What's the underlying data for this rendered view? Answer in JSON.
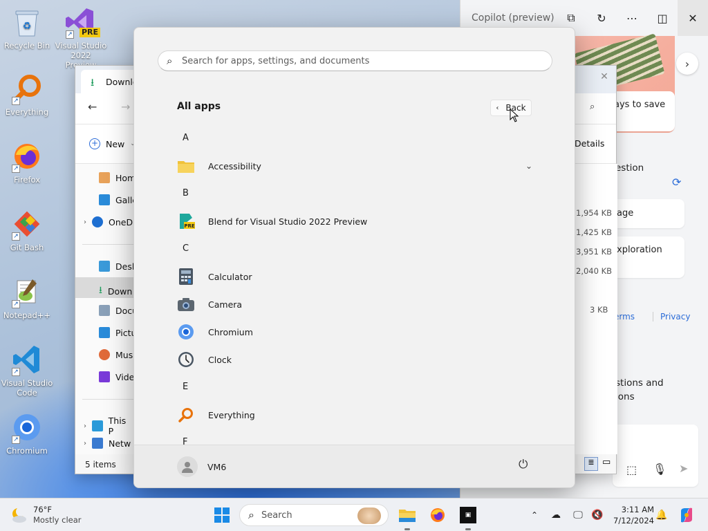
{
  "desktop": {
    "icons": [
      {
        "label": "Recycle Bin",
        "icon": "recycle-bin-icon"
      },
      {
        "label": "Visual Studio 2022 Preview",
        "icon": "visual-studio-preview-icon",
        "badge": "PRE"
      },
      {
        "label": "Everything",
        "icon": "everything-icon"
      },
      {
        "label": "Firefox",
        "icon": "firefox-icon"
      },
      {
        "label": "Git Bash",
        "icon": "git-bash-icon"
      },
      {
        "label": "Notepad++",
        "icon": "notepad-plus-plus-icon"
      },
      {
        "label": "Visual Studio Code",
        "icon": "vscode-icon"
      },
      {
        "label": "Chromium",
        "icon": "chromium-icon"
      }
    ]
  },
  "copilot": {
    "title": "Copilot (preview)",
    "card_text": "ays to save",
    "items": [
      "estion",
      "age",
      "xploration"
    ],
    "links": [
      "erms",
      "Privacy"
    ],
    "bottom_text": "stions and ions"
  },
  "explorer": {
    "tab": "Downlo",
    "new_label": "New",
    "details_label": "Details",
    "nav": [
      "Home",
      "Galler",
      "OneD",
      "Deskt",
      "Down",
      "Docu",
      "Pictur",
      "Music",
      "Video",
      "This P",
      "Netw"
    ],
    "sizes": [
      "1,954 KB",
      "1,425 KB",
      "3,951 KB",
      "2,040 KB",
      "3 KB"
    ],
    "status": "5 items"
  },
  "start_menu": {
    "search_placeholder": "Search for apps, settings, and documents",
    "heading": "All apps",
    "back_label": "Back",
    "groups": [
      {
        "letter": "A",
        "apps": [
          {
            "name": "Accessibility",
            "icon": "folder-icon",
            "expandable": true
          }
        ]
      },
      {
        "letter": "B",
        "apps": [
          {
            "name": "Blend for Visual Studio 2022 Preview",
            "icon": "blend-icon"
          }
        ]
      },
      {
        "letter": "C",
        "apps": [
          {
            "name": "Calculator",
            "icon": "calculator-icon"
          },
          {
            "name": "Camera",
            "icon": "camera-icon"
          },
          {
            "name": "Chromium",
            "icon": "chromium-icon"
          },
          {
            "name": "Clock",
            "icon": "clock-icon"
          }
        ]
      },
      {
        "letter": "E",
        "apps": [
          {
            "name": "Everything",
            "icon": "everything-icon"
          }
        ]
      },
      {
        "letter": "F",
        "apps": []
      }
    ],
    "user": "VM6"
  },
  "taskbar": {
    "weather_temp": "76°F",
    "weather_desc": "Mostly clear",
    "search_label": "Search",
    "time": "3:11 AM",
    "date": "7/12/2024"
  }
}
